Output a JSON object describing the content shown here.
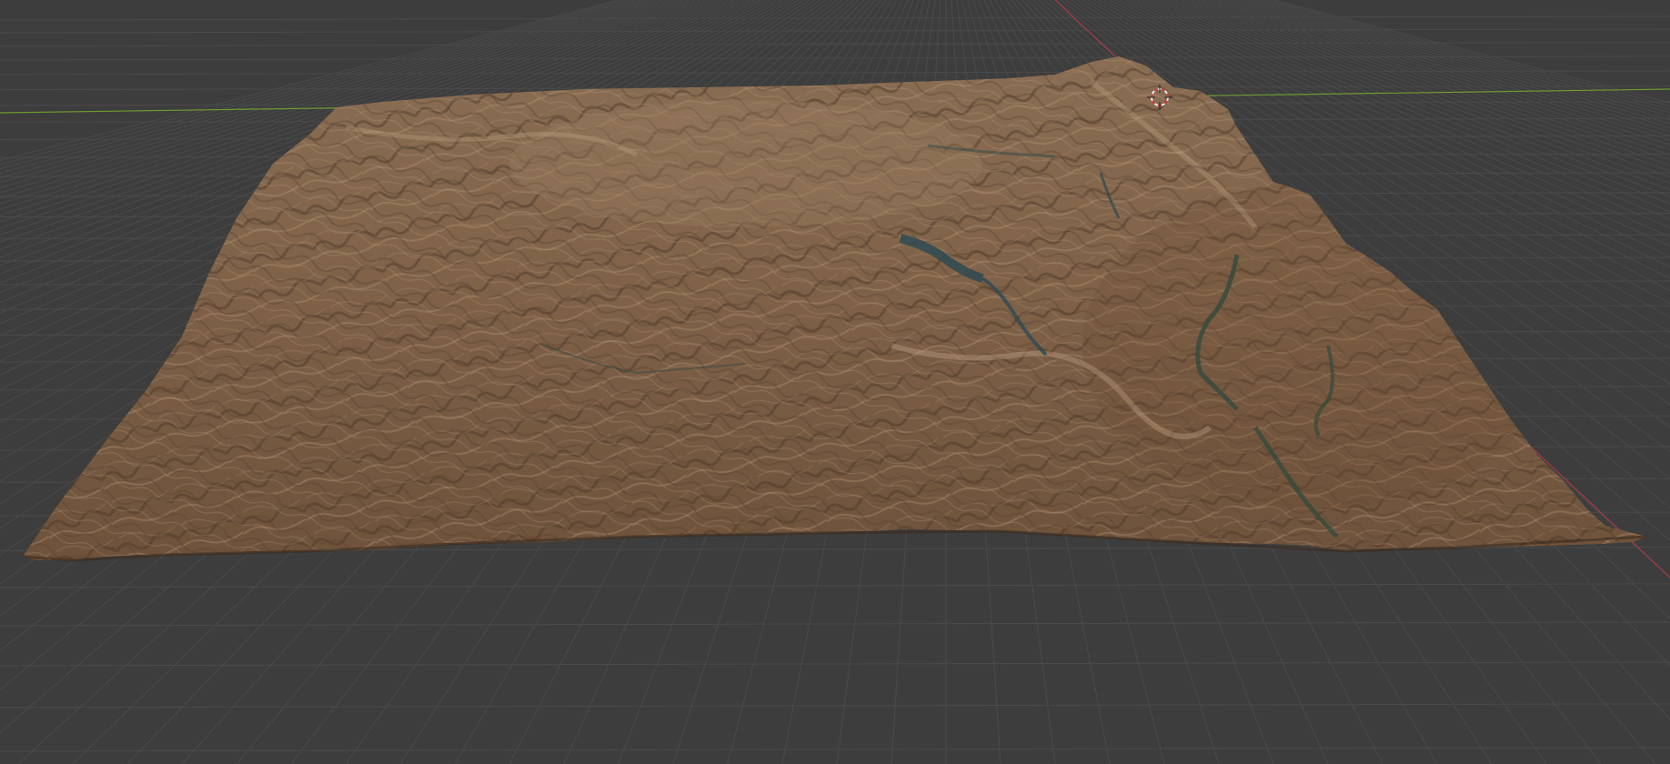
{
  "viewport": {
    "background_color": "#3d3d3d",
    "grid_color": "#4a4a4a",
    "x_axis_color": "#a83a4a",
    "y_axis_color": "#6e9a30"
  },
  "terrain": {
    "base_color": "#7f6248",
    "highlight_color": "#b99a78",
    "shadow_color": "#4a3526",
    "water_color": "#2e4a52"
  },
  "cursor_3d": {
    "icon": "3d-cursor-icon",
    "ring_color_a": "#e8e8e8",
    "ring_color_b": "#c84040"
  }
}
